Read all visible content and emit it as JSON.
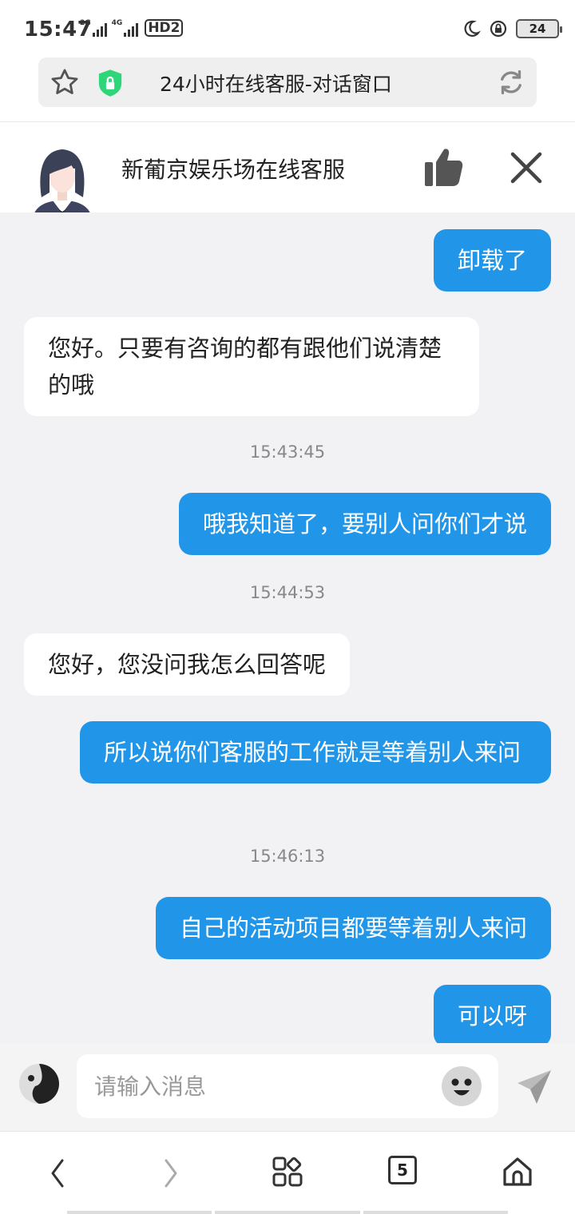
{
  "status_bar": {
    "time": "15:47",
    "net1": "2G",
    "net2": "4G",
    "hd": "HD2",
    "battery": "24"
  },
  "browser": {
    "title": "24小时在线客服-对话窗口",
    "tabs_count": "5"
  },
  "chat_header": {
    "title": "新葡京娱乐场在线客服"
  },
  "messages": [
    {
      "kind": "out",
      "text": "卸载了"
    },
    {
      "kind": "in",
      "text": "您好。只要有咨询的都有跟他们说清楚的哦"
    },
    {
      "kind": "time",
      "text": "15:43:45"
    },
    {
      "kind": "out",
      "text": "哦我知道了，要别人问你们才说"
    },
    {
      "kind": "time",
      "text": "15:44:53"
    },
    {
      "kind": "in",
      "text": "您好，您没问我怎么回答呢"
    },
    {
      "kind": "out",
      "text": "所以说你们客服的工作就是等着别人来问"
    },
    {
      "kind": "time",
      "text": "15:46:13"
    },
    {
      "kind": "out",
      "text": "自己的活动项目都要等着别人来问"
    },
    {
      "kind": "out",
      "text": "可以呀"
    }
  ],
  "input": {
    "placeholder": "请输入消息",
    "value": ""
  },
  "colors": {
    "outgoing_bubble": "#2196e8",
    "chat_background": "#f2f2f4",
    "shield": "#2ed67a"
  },
  "icons": {
    "star": "star-icon",
    "shield": "shield-lock-icon",
    "reload": "reload-icon",
    "like": "thumbs-up-icon",
    "close": "close-icon",
    "emoji": "emoji-icon",
    "send": "send-icon",
    "back": "back-icon",
    "forward": "forward-icon",
    "apps": "apps-icon",
    "home": "home-icon"
  }
}
